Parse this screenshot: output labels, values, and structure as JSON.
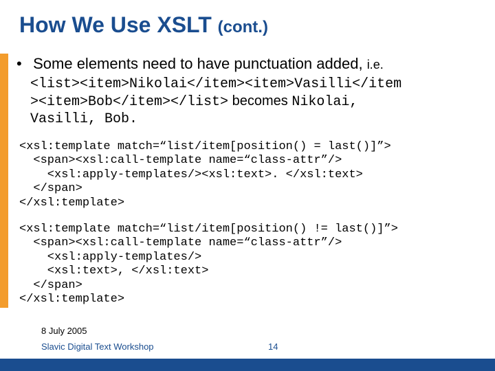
{
  "title_main": "How We Use XSLT ",
  "title_cont": "(cont.)",
  "bullet_dot": "•",
  "bullet_text": " Some elements need to have punctuation added, ",
  "bullet_ie": "i.e.",
  "example_line1": "<list><item>Nikolai</item><item>Vasilli</item",
  "example_line2a": "><item>Bob</item></list>",
  "example_line2b": " becomes ",
  "example_line2c": "Nikolai,",
  "example_line3": "Vasilli, Bob.",
  "code1": "<xsl:template match=“list/item[position() = last()]”>\n  <span><xsl:call-template name=“class-attr”/>\n    <xsl:apply-templates/><xsl:text>. </xsl:text>\n  </span>\n</xsl:template>",
  "code2": "<xsl:template match=“list/item[position() != last()]”>\n  <span><xsl:call-template name=“class-attr”/>\n    <xsl:apply-templates/>\n    <xsl:text>, </xsl:text>\n  </span>\n</xsl:template>",
  "footer_date": "8 July 2005",
  "footer_workshop": "Slavic Digital Text Workshop",
  "page_number": "14"
}
